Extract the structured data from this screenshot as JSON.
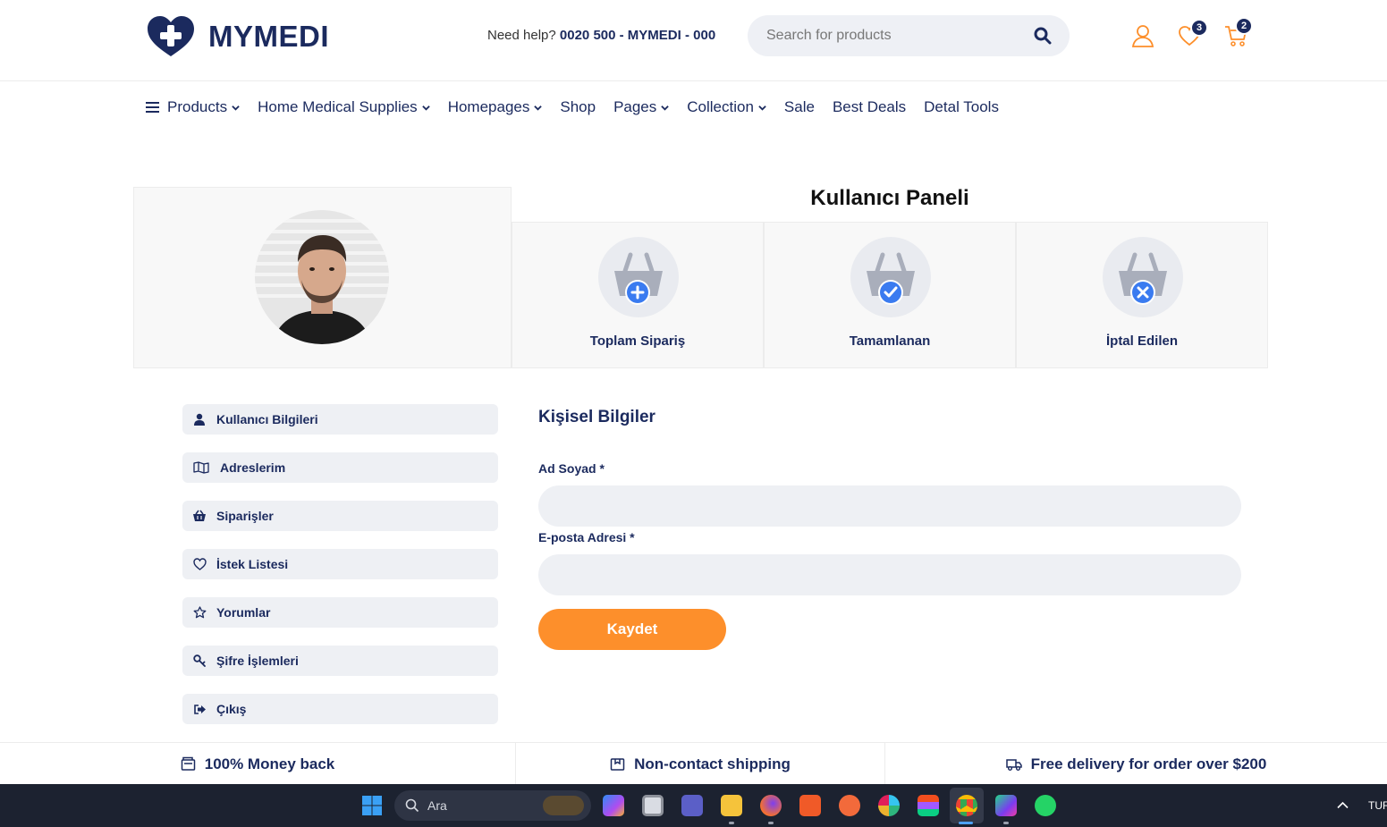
{
  "brand": {
    "name": "MYMEDI",
    "primary": "#1b2a5e",
    "accent": "#fd8f2b",
    "accent_blue": "#3a7bf0"
  },
  "header": {
    "help_prefix": "Need help?",
    "help_phone": "0020 500 - MYMEDI - 000",
    "search_placeholder": "Search for products",
    "wishlist_count": "3",
    "cart_count": "2"
  },
  "nav": {
    "items": [
      {
        "label": "Products",
        "dropdown": true
      },
      {
        "label": "Home Medical Supplies",
        "dropdown": true
      },
      {
        "label": "Homepages",
        "dropdown": true
      },
      {
        "label": "Shop",
        "dropdown": false
      },
      {
        "label": "Pages",
        "dropdown": true
      },
      {
        "label": "Collection",
        "dropdown": true
      },
      {
        "label": "Sale",
        "dropdown": false
      },
      {
        "label": "Best Deals",
        "dropdown": false
      },
      {
        "label": "Detal Tools",
        "dropdown": false
      }
    ]
  },
  "panel": {
    "title": "Kullanıcı Paneli",
    "stats": [
      {
        "label": "Toplam Sipariş",
        "icon": "basket-plus-icon"
      },
      {
        "label": "Tamamlanan",
        "icon": "basket-check-icon"
      },
      {
        "label": "İptal Edilen",
        "icon": "basket-x-icon"
      }
    ]
  },
  "sidebar": {
    "items": [
      {
        "label": "Kullanıcı Bilgileri",
        "icon": "user-icon"
      },
      {
        "label": "Adreslerim",
        "icon": "map-icon"
      },
      {
        "label": "Siparişler",
        "icon": "basket-icon"
      },
      {
        "label": "İstek Listesi",
        "icon": "heart-icon"
      },
      {
        "label": "Yorumlar",
        "icon": "star-icon"
      },
      {
        "label": "Şifre İşlemleri",
        "icon": "key-icon"
      },
      {
        "label": "Çıkış",
        "icon": "logout-icon"
      }
    ]
  },
  "form": {
    "title": "Kişisel Bilgiler",
    "name_label": "Ad Soyad *",
    "name_value": "",
    "email_label": "E-posta Adresi *",
    "email_value": "",
    "save_label": "Kaydet"
  },
  "features": {
    "items": [
      {
        "label": "100% Money back"
      },
      {
        "label": "Non-contact shipping"
      },
      {
        "label": "Free delivery for order over $200"
      }
    ]
  },
  "taskbar": {
    "search_label": "Ara",
    "lang": "TUR"
  }
}
